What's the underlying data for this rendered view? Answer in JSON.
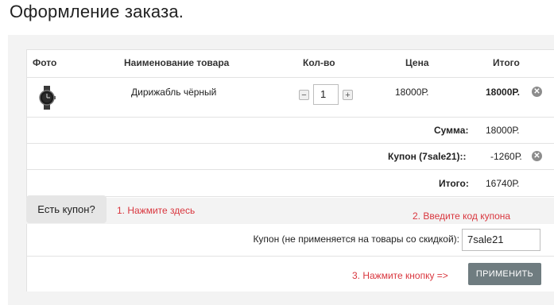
{
  "page": {
    "title": "Оформление заказа."
  },
  "cart": {
    "headers": {
      "photo": "Фото",
      "name": "Наименование товара",
      "qty": "Кол-во",
      "price": "Цена",
      "total": "Итого"
    },
    "item": {
      "name": "Дирижабль чёрный",
      "qty_minus": "−",
      "qty_value": "1",
      "qty_plus": "+",
      "price": "18000Р.",
      "total": "18000Р.",
      "remove_icon": "close-circle-icon"
    },
    "summary": {
      "sum_label": "Сумма:",
      "sum_value": "18000Р.",
      "coupon_label": "Купон (7sale21)::",
      "coupon_value": "-1260Р.",
      "total_label": "Итого:",
      "total_value": "16740Р."
    }
  },
  "coupon": {
    "toggle_label": "Есть купон?",
    "hint_1": "1. Нажмите здесь",
    "hint_2": "2. Введите код купона",
    "hint_3": "3. Нажмите кнопку =>",
    "field_label": "Купон (не применяется на товары со скидкой):",
    "field_value": "7sale21",
    "apply_label": "ПРИМЕНИТЬ"
  },
  "colors": {
    "hint": "#d9363e",
    "apply_button": "#6f7c80",
    "panel_bg": "#f3f3f3"
  }
}
